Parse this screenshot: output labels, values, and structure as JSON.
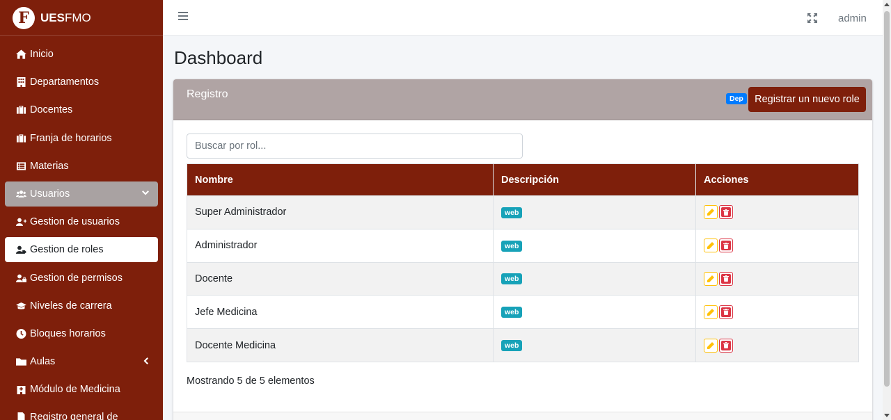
{
  "brand": {
    "logo_letter": "F",
    "name_bold": "UES",
    "name_rest": "FMO"
  },
  "sidebar": {
    "items": [
      {
        "label": "Inicio",
        "icon": "home-icon"
      },
      {
        "label": "Departamentos",
        "icon": "building-icon"
      },
      {
        "label": "Docentes",
        "icon": "briefcase-icon"
      },
      {
        "label": "Franja de horarios",
        "icon": "briefcase-icon"
      },
      {
        "label": "Materias",
        "icon": "list-icon"
      },
      {
        "label": "Usuarios",
        "icon": "users-icon",
        "expanded": true
      },
      {
        "label": "Gestion de usuarios",
        "icon": "user-plus-icon"
      },
      {
        "label": "Gestion de roles",
        "icon": "user-tag-icon",
        "active": true
      },
      {
        "label": "Gestion de permisos",
        "icon": "user-lock-icon"
      },
      {
        "label": "Niveles de carrera",
        "icon": "graduation-icon"
      },
      {
        "label": "Bloques horarios",
        "icon": "clock-icon"
      },
      {
        "label": "Aulas",
        "icon": "folder-icon"
      },
      {
        "label": "Módulo de Medicina",
        "icon": "hospital-icon"
      },
      {
        "label": "Registro general de",
        "icon": "file-icon"
      }
    ]
  },
  "topbar": {
    "user": "admin"
  },
  "page": {
    "title": "Dashboard"
  },
  "card": {
    "title": "Registro",
    "badge": "Dep",
    "new_button": "Registrar un nuevo role",
    "search_placeholder": "Buscar por rol...",
    "columns": [
      "Nombre",
      "Descripción",
      "Acciones"
    ],
    "rows": [
      {
        "nombre": "Super Administrador",
        "descripcion": "web"
      },
      {
        "nombre": "Administrador",
        "descripcion": "web"
      },
      {
        "nombre": "Docente",
        "descripcion": "web"
      },
      {
        "nombre": "Jefe Medicina",
        "descripcion": "web"
      },
      {
        "nombre": "Docente Medicina",
        "descripcion": "web"
      }
    ],
    "count_text": "Mostrando 5 de 5 elementos"
  },
  "colors": {
    "primary": "#7e1f0b",
    "header_gray": "#b0a4a4",
    "badge_web": "#17a2b8",
    "badge_dep": "#007bff",
    "edit": "#ffc107",
    "delete": "#dc3545"
  }
}
